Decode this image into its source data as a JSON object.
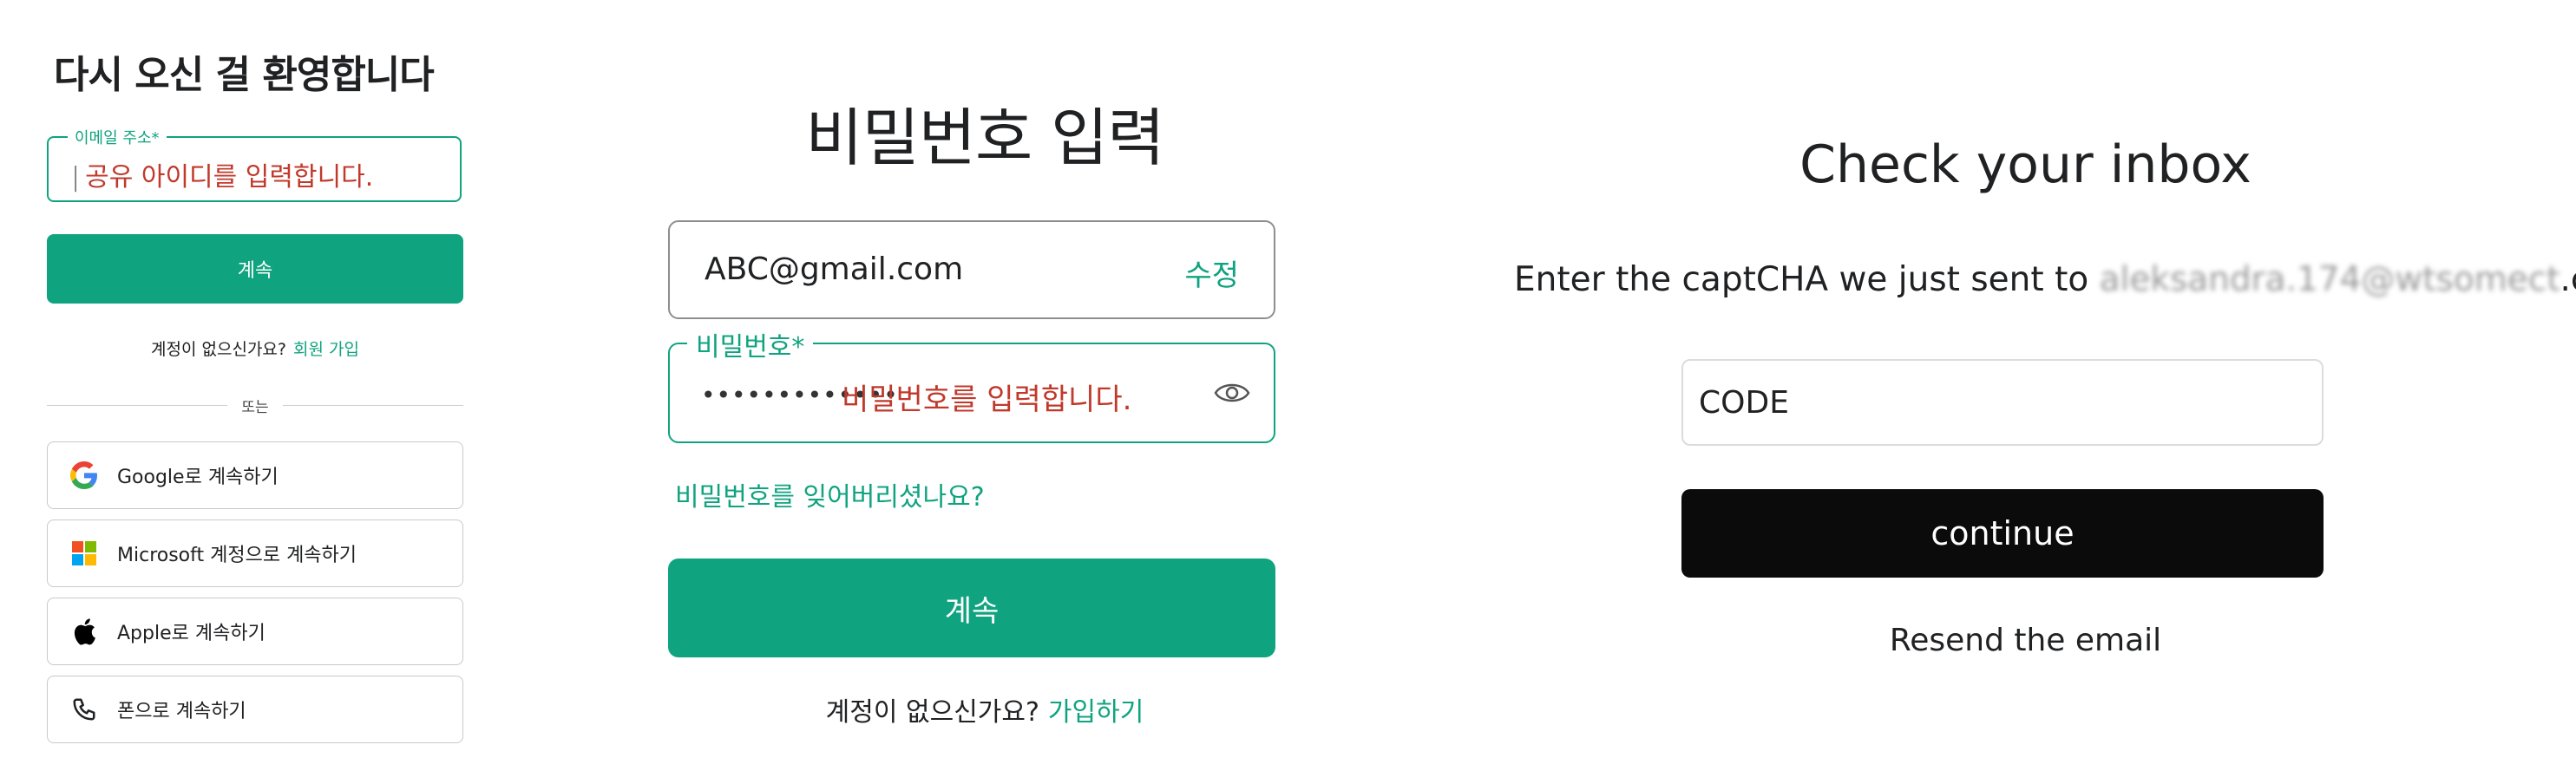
{
  "login": {
    "title": "다시 오신 걸 환영합니다",
    "email_label": "이메일 주소*",
    "email_value": "공유 아이디를 입력합니다.",
    "email_caret": "|",
    "continue_label": "계속",
    "no_account_text": "계정이 없으신가요?",
    "signup_link": "회원 가입",
    "divider_text": "또는",
    "social_buttons": [
      {
        "label": "Google로 계속하기",
        "icon": "google-icon"
      },
      {
        "label": "Microsoft 계정으로 계속하기",
        "icon": "microsoft-icon"
      },
      {
        "label": "Apple로 계속하기",
        "icon": "apple-icon"
      },
      {
        "label": "폰으로 계속하기",
        "icon": "phone-icon"
      }
    ],
    "colors": {
      "accent": "#10a37f",
      "annotation": "#c0392b"
    }
  },
  "password": {
    "title": "비밀번호 입력",
    "email_value": "ABC@gmail.com",
    "edit_label": "수정",
    "password_label": "비밀번호*",
    "password_mask": "•••••••••••••",
    "password_hint": "비밀번호를 입력합니다.",
    "eye_icon": "eye-icon",
    "forgot_link": "비밀번호를 잊어버리셨나요?",
    "continue_label": "계속",
    "no_account_text": "계정이 없으신가요?",
    "signup_link": "가입하기"
  },
  "captcha": {
    "title": "Check your inbox",
    "desc_prefix": "Enter the captCHA we just sent to",
    "desc_obscured": "aleksandra.174@wtsomect",
    "desc_suffix": ".com.",
    "code_value": "CODE",
    "continue_label": "continue",
    "resend_label": "Resend the email"
  }
}
